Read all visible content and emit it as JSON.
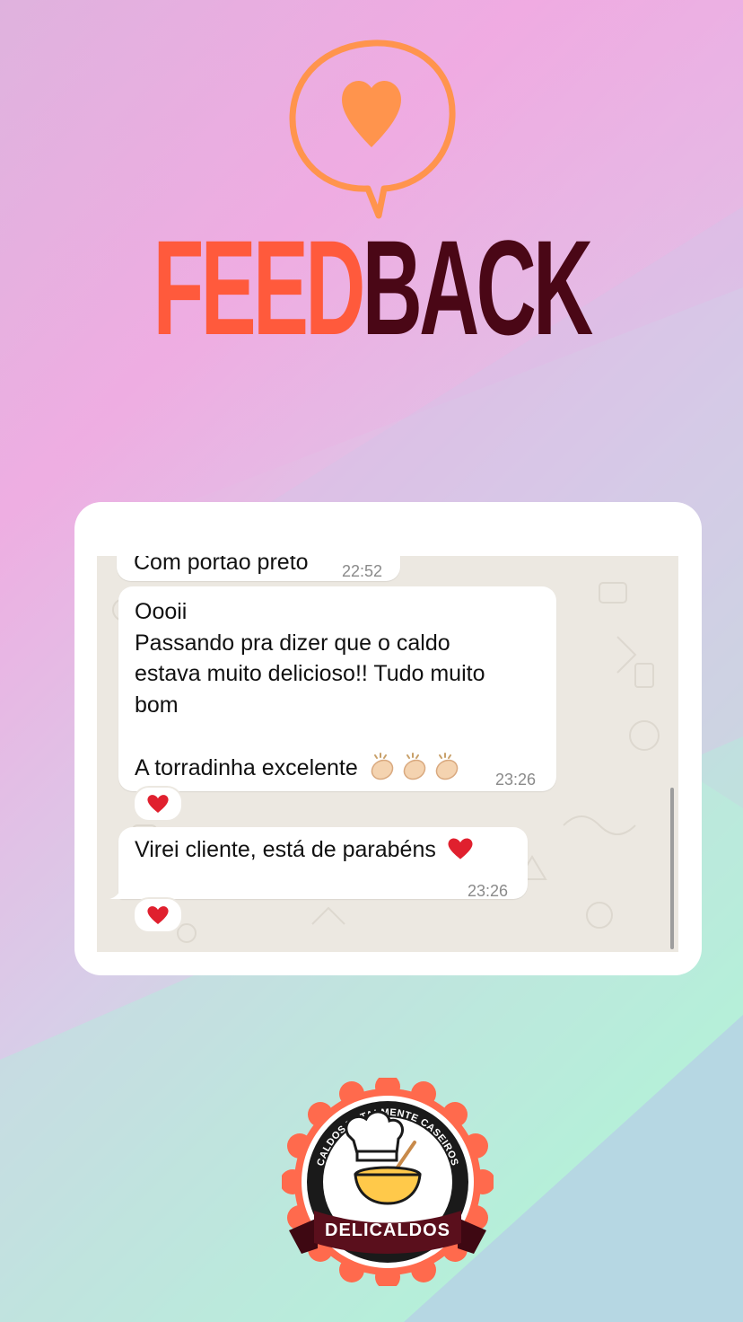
{
  "header": {
    "title_part1": "FEED",
    "title_part2": "BACK"
  },
  "chat": {
    "messages": [
      {
        "text": "Com portão preto",
        "time": "22:52"
      },
      {
        "lines": [
          "Oooii",
          "Passando pra dizer que o caldo",
          "estava muito delicioso!! Tudo muito",
          "bom",
          "",
          "A torradinha excelente"
        ],
        "time": "23:26",
        "reaction": "heart"
      },
      {
        "text": "Virei cliente, está de parabéns",
        "time": "23:26",
        "reaction": "heart"
      }
    ]
  },
  "logo": {
    "arc_text": "CALDOS TOTALMENTE CASEIROS",
    "brand": "DELICALDOS"
  },
  "colors": {
    "feed": "#ff5a3c",
    "back": "#4a0716",
    "icon": "#ff944d",
    "logo_ring": "#ff6a4d",
    "logo_ribbon": "#5a0f1c"
  }
}
